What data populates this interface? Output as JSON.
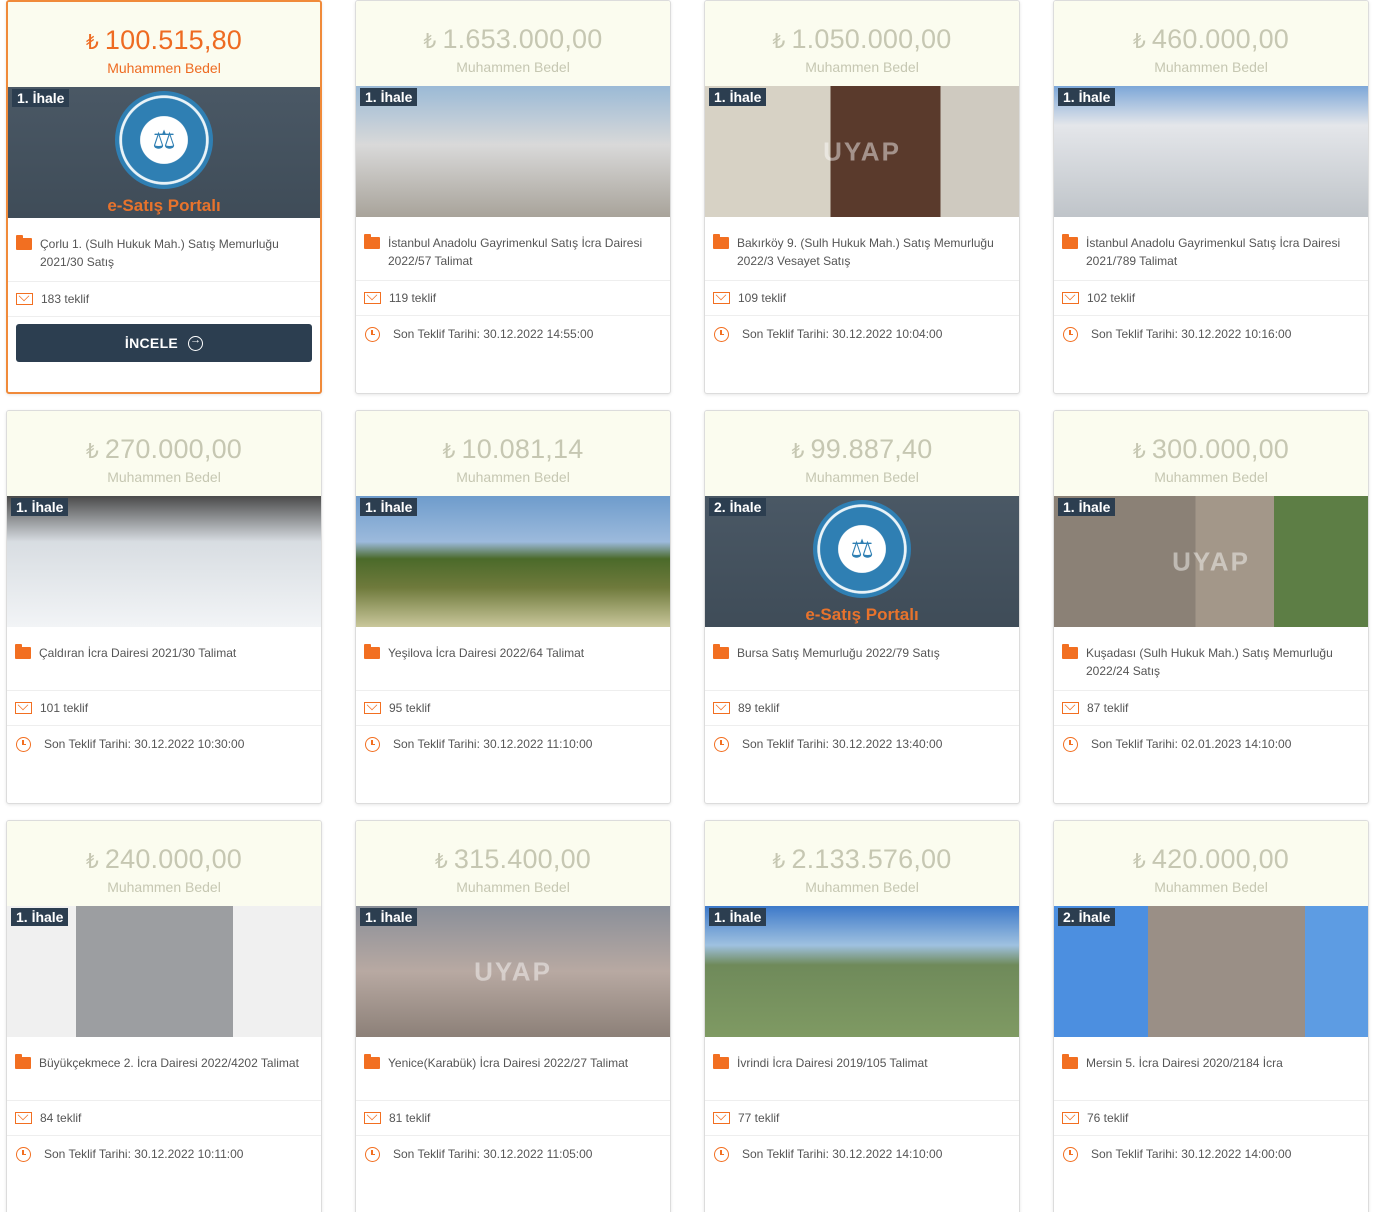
{
  "common": {
    "price_label": "Muhammen Bedel",
    "currency_symbol": "₺",
    "incele_label": "İNCELE"
  },
  "cards": [
    {
      "price": "100.515,80",
      "round": "1. İhale",
      "image": "portal",
      "title": "Çorlu 1. (Sulh Hukuk Mah.) Satış Memurluğu 2021/30 Satış",
      "offers": "183 teklif",
      "date": "",
      "portal_text": "e-Satış Portalı",
      "active": true
    },
    {
      "price": "1.653.000,00",
      "round": "1. İhale",
      "image": "building",
      "title": "İstanbul Anadolu Gayrimenkul Satış İcra Dairesi 2022/57 Talimat",
      "offers": "119 teklif",
      "date": "Son Teklif Tarihi: 30.12.2022 14:55:00"
    },
    {
      "price": "1.050.000,00",
      "round": "1. İhale",
      "image": "door",
      "title": "Bakırköy 9. (Sulh Hukuk Mah.) Satış Memurluğu 2022/3 Vesayet Satış",
      "offers": "109 teklif",
      "date": "Son Teklif Tarihi: 30.12.2022 10:04:00",
      "watermark": "UYAP"
    },
    {
      "price": "460.000,00",
      "round": "1. İhale",
      "image": "tower",
      "title": "İstanbul Anadolu Gayrimenkul Satış İcra Dairesi 2021/789 Talimat",
      "offers": "102 teklif",
      "date": "Son Teklif Tarihi: 30.12.2022 10:16:00"
    },
    {
      "price": "270.000,00",
      "round": "1. İhale",
      "image": "car-white",
      "title": "Çaldıran İcra Dairesi 2021/30 Talimat",
      "offers": "101 teklif",
      "date": "Son Teklif Tarihi: 30.12.2022 10:30:00"
    },
    {
      "price": "10.081,14",
      "round": "1. İhale",
      "image": "field",
      "title": "Yeşilova İcra Dairesi 2022/64 Talimat",
      "offers": "95 teklif",
      "date": "Son Teklif Tarihi: 30.12.2022 11:10:00"
    },
    {
      "price": "99.887,40",
      "round": "2. İhale",
      "image": "portal",
      "title": "Bursa Satış Memurluğu 2022/79 Satış",
      "offers": "89 teklif",
      "date": "Son Teklif Tarihi: 30.12.2022 13:40:00",
      "portal_text": "e-Satış Portalı"
    },
    {
      "price": "300.000,00",
      "round": "1. İhale",
      "image": "house",
      "title": "Kuşadası (Sulh Hukuk Mah.) Satış Memurluğu 2022/24 Satış",
      "offers": "87 teklif",
      "date": "Son Teklif Tarihi: 02.01.2023 14:10:00",
      "watermark": "UYAP"
    },
    {
      "price": "240.000,00",
      "round": "1. İhale",
      "image": "wreck",
      "title": "Büyükçekmece 2. İcra Dairesi 2022/4202 Talimat",
      "offers": "84 teklif",
      "date": "Son Teklif Tarihi: 30.12.2022 10:11:00"
    },
    {
      "price": "315.400,00",
      "round": "1. İhale",
      "image": "apt",
      "title": "Yenice(Karabük) İcra Dairesi 2022/27 Talimat",
      "offers": "81 teklif",
      "date": "Son Teklif Tarihi: 30.12.2022 11:05:00",
      "watermark": "UYAP"
    },
    {
      "price": "2.133.576,00",
      "round": "1. İhale",
      "image": "grass",
      "title": "İvrindi İcra Dairesi 2019/105 Talimat",
      "offers": "77 teklif",
      "date": "Son Teklif Tarihi: 30.12.2022 14:10:00"
    },
    {
      "price": "420.000,00",
      "round": "2. İhale",
      "image": "mersin",
      "title": "Mersin 5. İcra Dairesi 2020/2184 İcra",
      "offers": "76 teklif",
      "date": "Son Teklif Tarihi: 30.12.2022 14:00:00"
    }
  ]
}
